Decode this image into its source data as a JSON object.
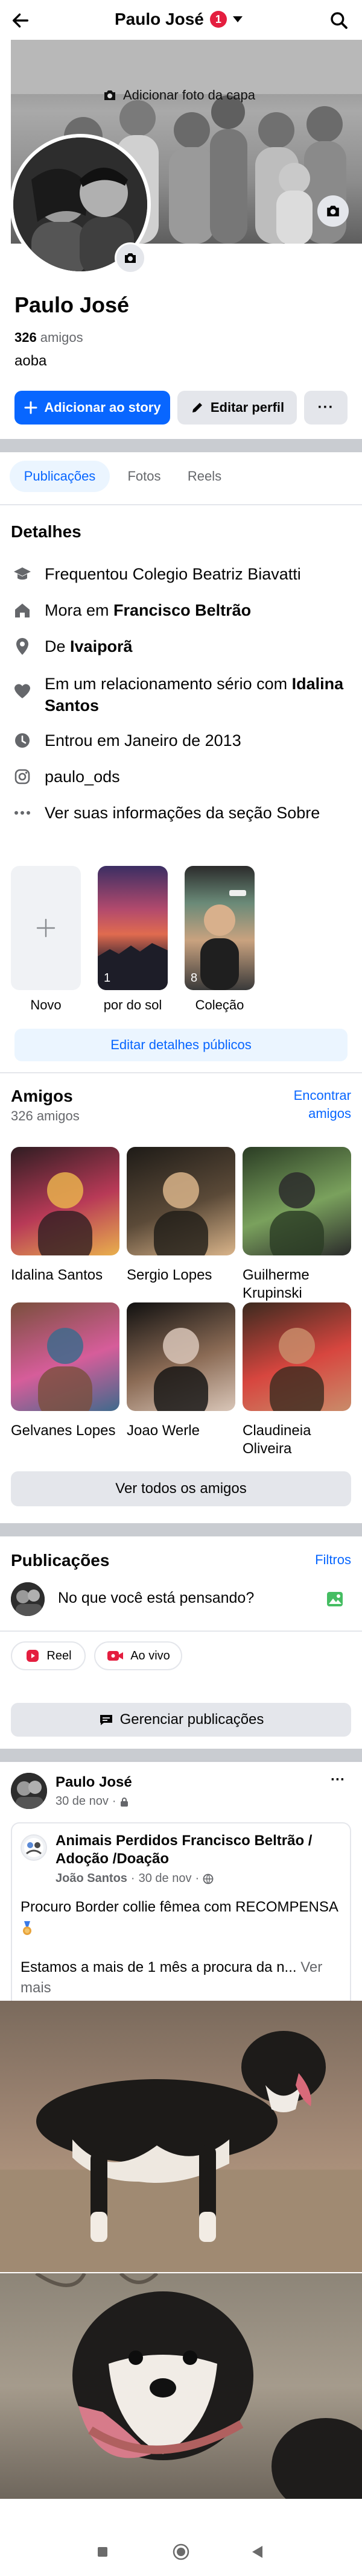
{
  "topbar": {
    "name": "Paulo José",
    "badge": "1"
  },
  "cover": {
    "add_cover_label": "Adicionar foto da capa"
  },
  "profile": {
    "name": "Paulo José",
    "friends_count": "326",
    "friends_word": "amigos",
    "bio": "aoba"
  },
  "actions": {
    "add_story": "Adicionar ao story",
    "edit_profile": "Editar perfil",
    "more": "···"
  },
  "tabs": [
    "Publicações",
    "Fotos",
    "Reels"
  ],
  "details": {
    "title": "Detalhes",
    "study": "Frequentou Colegio Beatriz Biavatti",
    "lives_prefix": "Mora em ",
    "lives_city": "Francisco Beltrão",
    "from_prefix": "De ",
    "from_city": "Ivaiporã",
    "relationship_prefix": "Em um relacionamento sério com ",
    "relationship_name": "Idalina Santos",
    "joined": "Entrou em Janeiro de 2013",
    "instagram": "paulo_ods",
    "about_link": "Ver suas informações da seção Sobre"
  },
  "highlights": {
    "items": [
      {
        "label": "Novo",
        "count": ""
      },
      {
        "label": "por do sol",
        "count": "1"
      },
      {
        "label": "Coleção",
        "count": "8"
      }
    ],
    "edit_button": "Editar detalhes públicos"
  },
  "friends": {
    "title": "Amigos",
    "count_text": "326 amigos",
    "find_link_1": "Encontrar",
    "find_link_2": "amigos",
    "items": [
      {
        "name": "Idalina Santos",
        "colors": [
          "#2f1d22",
          "#b83a57",
          "#e9b04d"
        ]
      },
      {
        "name": "Sergio Lopes",
        "colors": [
          "#1e1b17",
          "#5b4a38",
          "#d9b48a"
        ]
      },
      {
        "name": "Guilherme Krupinski",
        "colors": [
          "#2a3c24",
          "#7aa15d",
          "#2b2b2b"
        ]
      },
      {
        "name": "Gelvanes Lopes",
        "colors": [
          "#7a4f3c",
          "#d65d9a",
          "#3f6a8c"
        ]
      },
      {
        "name": "Joao Werle",
        "colors": [
          "#101010",
          "#8b6b55",
          "#d9c6b8"
        ]
      },
      {
        "name": "Claudineia Oliveira",
        "colors": [
          "#3b2a1f",
          "#d7463f",
          "#c98c6a"
        ]
      }
    ],
    "see_all": "Ver todos os amigos"
  },
  "posts_section": {
    "title": "Publicações",
    "filters": "Filtros",
    "composer_placeholder": "No que você está pensando?",
    "reel_label": "Reel",
    "live_label": "Ao vivo",
    "manage": "Gerenciar publicações"
  },
  "post": {
    "author": "Paulo José",
    "date": "30 de nov",
    "more": "···",
    "shared_group": "Animais Perdidos Francisco Beltrão / Adoção /Doação",
    "shared_author": "João Santos",
    "shared_date": "30 de nov",
    "text_line1": "Procuro Border collie fêmea com RECOMPENSA",
    "text_line2": "Estamos a mais de 1 mês a procura da n...",
    "see_more": "Ver mais"
  },
  "colors": {
    "accent": "#0866ff",
    "accent_light": "#ebf5ff",
    "grey_button": "#e4e6eb",
    "separator": "#c9ccd1",
    "secondary_text": "#65676b",
    "badge_red": "#e41e3f"
  }
}
